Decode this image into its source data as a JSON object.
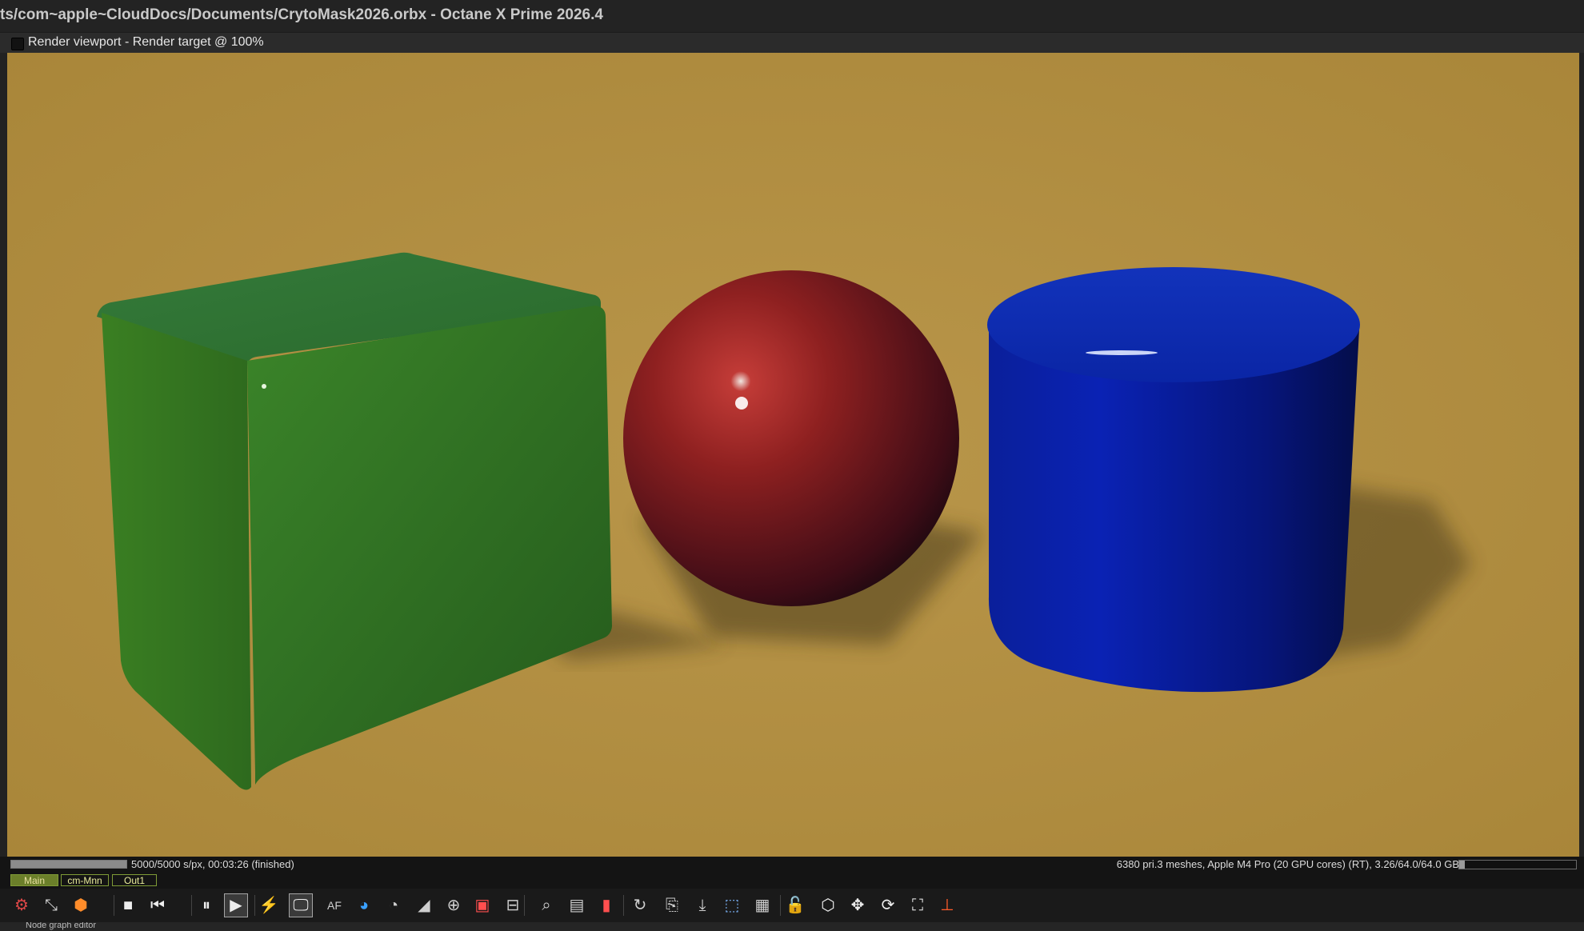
{
  "window": {
    "title": "ts/com~apple~CloudDocs/Documents/CrytoMask2026.orbx - Octane X Prime 2026.4"
  },
  "viewport": {
    "header_label": "Render viewport - Render target @ 100%",
    "background_color": "#b59145",
    "objects": [
      {
        "kind": "cube",
        "color": "#2e6a22"
      },
      {
        "kind": "sphere",
        "color": "#8b1e1e"
      },
      {
        "kind": "cylinder",
        "color": "#0a1f96"
      }
    ]
  },
  "status": {
    "progress_fraction": 1.0,
    "samples_text": "5000/5000 s/px, 00:03:26 (finished)",
    "gpu_text": "6380 pri.3 meshes, Apple M4 Pro (20 GPU cores) (RT), 3.26/64.0/64.0 GB",
    "memory_fraction": 0.05
  },
  "tabs": [
    {
      "label": "Main",
      "active": true
    },
    {
      "label": "cm-Mnn",
      "active": false
    },
    {
      "label": "Out1",
      "active": false
    }
  ],
  "toolbar": {
    "buttons": [
      {
        "name": "render-settings-icon",
        "glyph": "⚙",
        "color": "#e04848"
      },
      {
        "name": "region-render-icon",
        "glyph": "⤡",
        "color": "#cfcfcf"
      },
      {
        "name": "material-picker-icon",
        "glyph": "⬢",
        "color": "#ff8c2a"
      },
      {
        "name": "stop-icon",
        "glyph": "■",
        "color": "#eeeeee"
      },
      {
        "name": "restart-icon",
        "glyph": "⏮",
        "color": "#eeeeee"
      },
      {
        "name": "pause-icon",
        "glyph": "⏸",
        "color": "#eeeeee"
      },
      {
        "name": "play-icon",
        "glyph": "▶",
        "color": "#eeeeee"
      },
      {
        "name": "realtime-icon",
        "glyph": "⚡",
        "color": "#eeeeee"
      },
      {
        "name": "display-icon",
        "glyph": "🖵",
        "color": "#eeeeee"
      },
      {
        "name": "auto-focus-icon",
        "glyph": "AF",
        "color": "#cfcfcf"
      },
      {
        "name": "color-picker-icon",
        "glyph": "◕",
        "color": "#3aa0ff"
      },
      {
        "name": "white-balance-icon",
        "glyph": "◔",
        "color": "#cfcfcf"
      },
      {
        "name": "focus-picker-icon",
        "glyph": "◢",
        "color": "#cfcfcf"
      },
      {
        "name": "camera-target-icon",
        "glyph": "⊕",
        "color": "#cfcfcf"
      },
      {
        "name": "render-region-icon",
        "glyph": "▣",
        "color": "#ff4f4f"
      },
      {
        "name": "film-region-icon",
        "glyph": "⊟",
        "color": "#cfcfcf"
      },
      {
        "name": "zoom-icon",
        "glyph": "⌕",
        "color": "#cfcfcf"
      },
      {
        "name": "object-picker-icon",
        "glyph": "▤",
        "color": "#cfcfcf"
      },
      {
        "name": "material-override-icon",
        "glyph": "▮",
        "color": "#ff4f4f"
      },
      {
        "name": "lock-resolution-icon",
        "glyph": "↻",
        "color": "#cfcfcf"
      },
      {
        "name": "copy-to-clipboard-icon",
        "glyph": "⎘",
        "color": "#cfcfcf"
      },
      {
        "name": "save-render-icon",
        "glyph": "⤓",
        "color": "#cfcfcf"
      },
      {
        "name": "clay-render-icon",
        "glyph": "⬚",
        "color": "#7fb8ff"
      },
      {
        "name": "checker-icon",
        "glyph": "▦",
        "color": "#cfcfcf"
      },
      {
        "name": "lock-icon",
        "glyph": "🔓",
        "color": "#cfcfcf"
      },
      {
        "name": "cube-view-icon",
        "glyph": "⬡",
        "color": "#eeeeee"
      },
      {
        "name": "move-icon",
        "glyph": "✥",
        "color": "#eeeeee"
      },
      {
        "name": "rotate-icon",
        "glyph": "⟳",
        "color": "#eeeeee"
      },
      {
        "name": "fit-icon",
        "glyph": "⛶",
        "color": "#eeeeee"
      },
      {
        "name": "gizmo-axes-icon",
        "glyph": "⊥",
        "color": "#ff5c2a"
      }
    ]
  },
  "bottom_panel": {
    "label": "Node graph editor"
  }
}
